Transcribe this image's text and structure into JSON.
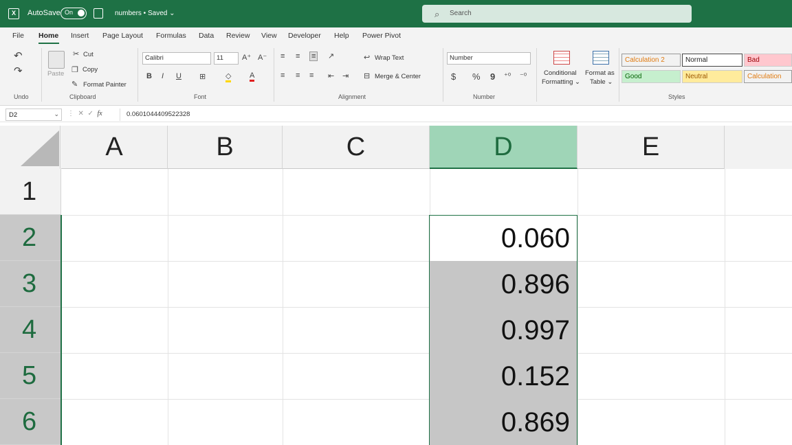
{
  "app": {
    "autosave_label": "AutoSave",
    "autosave_state": "On",
    "file_title": "numbers • Saved ⌄",
    "search_placeholder": "Search",
    "accent_color": "#1e7145"
  },
  "tabs": [
    "File",
    "Home",
    "Insert",
    "Page Layout",
    "Formulas",
    "Data",
    "Review",
    "View",
    "Developer",
    "Help",
    "Power Pivot"
  ],
  "ribbon": {
    "undo_label": "Undo",
    "clipboard": {
      "paste": "Paste",
      "cut": "Cut",
      "copy": "Copy",
      "format_painter": "Format Painter",
      "group": "Clipboard"
    },
    "font": {
      "name": "Calibri",
      "size": "11",
      "bold": "B",
      "italic": "I",
      "underline": "U",
      "group": "Font"
    },
    "alignment": {
      "wrap": "Wrap Text",
      "merge": "Merge & Center",
      "group": "Alignment"
    },
    "number": {
      "format": "Number",
      "currency": "$",
      "percent": "%",
      "comma": "9",
      "group": "Number"
    },
    "styles_buttons": {
      "conditional_1": "Conditional",
      "conditional_2": "Formatting ⌄",
      "table_1": "Format as",
      "table_2": "Table ⌄"
    },
    "styles": {
      "calc2": "Calculation 2",
      "normal": "Normal",
      "bad": "Bad",
      "good": "Good",
      "neutral": "Neutral",
      "calculation": "Calculation",
      "group": "Styles"
    }
  },
  "formula_bar": {
    "name_box": "D2",
    "fx": "fx",
    "value": "0.0601044409522328"
  },
  "grid": {
    "columns": [
      "A",
      "B",
      "C",
      "D",
      "E"
    ],
    "selected_column": "D",
    "rows": [
      "1",
      "2",
      "3",
      "4",
      "5",
      "6"
    ],
    "column_d_values": [
      "0.060",
      "0.896",
      "0.997",
      "0.152",
      "0.869"
    ]
  }
}
